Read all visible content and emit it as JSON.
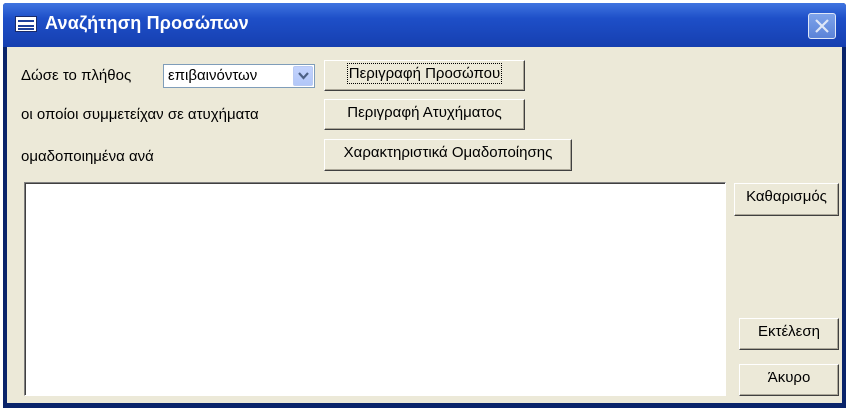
{
  "window": {
    "title": "Αναζήτηση Προσώπων"
  },
  "form": {
    "count_label": "Δώσε το πλήθος",
    "count_select": {
      "value": "επιβαινόντων"
    },
    "involved_label": "οι οποίοι συμμετείχαν σε ατυχήματα",
    "grouped_label": "ομαδοποιημένα ανά",
    "results_text": ""
  },
  "buttons": {
    "person_description": "Περιγραφή Προσώπου",
    "accident_description": "Περιγραφή Ατυχήματος",
    "grouping_features": "Χαρακτηριστικά Ομαδοποίησης",
    "clear": "Καθαρισμός",
    "execute": "Εκτέλεση",
    "cancel": "Άκυρο"
  },
  "icons": {
    "window": "form-icon",
    "close": "close-icon",
    "dropdown": "chevron-down-icon"
  }
}
